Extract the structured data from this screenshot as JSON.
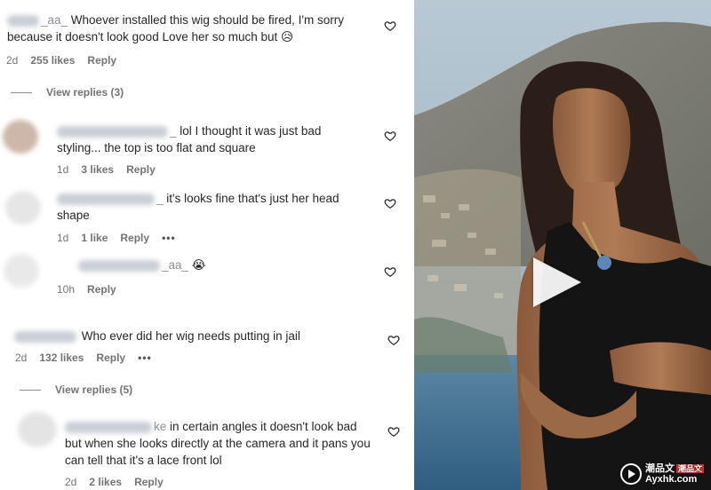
{
  "comments": [
    {
      "username_suffix": "_aa_",
      "text": " Whoever installed this wig should be fired, I'm sorry because it doesn't look good Love her so much but 😥",
      "time": "2d",
      "likes": "255 likes",
      "reply": "Reply"
    },
    {
      "username_suffix": "_",
      "text": " lol I thought it was just bad styling... the top is too flat and square",
      "time": "1d",
      "likes": "3 likes",
      "reply": "Reply"
    },
    {
      "username_suffix": "_",
      "text": " it's looks fine that's just her head shape",
      "time": "1d",
      "likes": "1 like",
      "reply": "Reply",
      "more": "•••"
    },
    {
      "username_suffix": "_aa_",
      "text": " 😭",
      "time": "10h",
      "reply": "Reply"
    },
    {
      "username_suffix": "",
      "text": " Who ever did her wig needs putting in jail",
      "time": "2d",
      "likes": "132 likes",
      "reply": "Reply",
      "more": "•••"
    },
    {
      "username_suffix": "ke",
      "text": " in certain angles it doesn't look bad but when she looks directly at the camera and it pans you can tell that it's a lace front lol",
      "time": "2d",
      "likes": "2 likes",
      "reply": "Reply"
    }
  ],
  "view_replies": [
    {
      "label": "View replies (3)"
    },
    {
      "label": "View replies (5)"
    }
  ],
  "watermark": {
    "site": "Ayxhk.com",
    "brand": "潮品文",
    "tag": "潮品文"
  },
  "colors": {
    "text": "#262626",
    "muted": "#737373",
    "sky": "#9fb6c8",
    "sea": "#3f6f92"
  }
}
